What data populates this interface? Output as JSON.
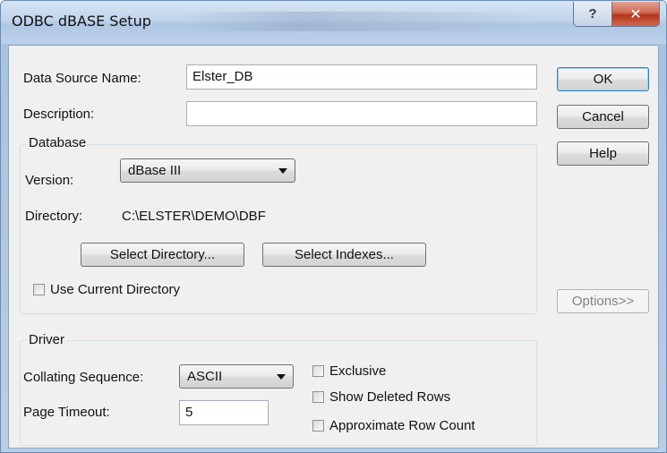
{
  "window": {
    "title": "ODBC dBASE Setup"
  },
  "titlebar_buttons": {
    "help": "?",
    "close": "✕"
  },
  "fields": {
    "data_source_name_label": "Data Source Name:",
    "data_source_name_value": "Elster_DB",
    "description_label": "Description:",
    "description_value": ""
  },
  "database": {
    "group_label": "Database",
    "version_label": "Version:",
    "version_value": "dBase III",
    "directory_label": "Directory:",
    "directory_value": "C:\\ELSTER\\DEMO\\DBF",
    "select_directory": "Select Directory...",
    "select_indexes": "Select Indexes...",
    "use_current_directory": "Use Current Directory"
  },
  "buttons": {
    "ok": "OK",
    "cancel": "Cancel",
    "help": "Help",
    "options": "Options>>"
  },
  "driver": {
    "group_label": "Driver",
    "collating_label": "Collating Sequence:",
    "collating_value": "ASCII",
    "page_timeout_label": "Page Timeout:",
    "page_timeout_value": "5",
    "exclusive": "Exclusive",
    "show_deleted_rows": "Show Deleted Rows",
    "approximate_row_count": "Approximate Row Count"
  }
}
